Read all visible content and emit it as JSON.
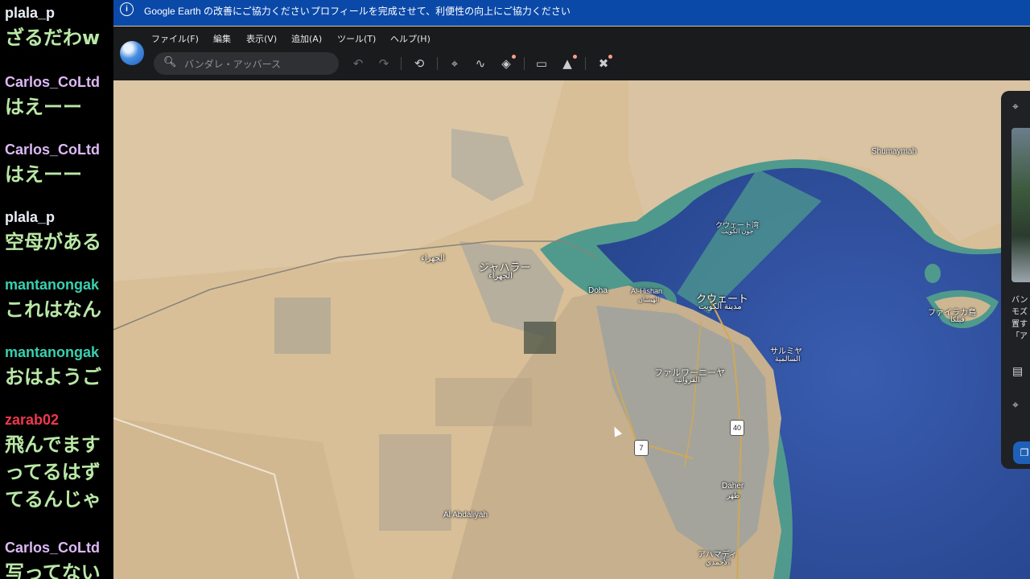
{
  "chat": {
    "messages": [
      {
        "user": "plala_p",
        "user_color": "#e9eef5",
        "lines": [
          "ざるだわw"
        ]
      },
      {
        "user": "Carlos_CoLtd",
        "user_color": "#dcb8f5",
        "lines": [
          "はえーー"
        ]
      },
      {
        "user": "Carlos_CoLtd",
        "user_color": "#dcb8f5",
        "lines": [
          "はえーー"
        ]
      },
      {
        "user": "plala_p",
        "user_color": "#e9eef5",
        "lines": [
          "空母がある"
        ]
      },
      {
        "user": "mantanongak",
        "user_color": "#39d0b0",
        "lines": [
          "これはなん"
        ]
      },
      {
        "user": "mantanongak",
        "user_color": "#39d0b0",
        "lines": [
          "おはようご"
        ]
      },
      {
        "user": "zarab02",
        "user_color": "#f0384c",
        "lines": [
          "飛んでます",
          "ってるはず",
          "てるんじゃ"
        ]
      },
      {
        "user": "Carlos_CoLtd",
        "user_color": "#dcb8f5",
        "lines": [
          "写ってない"
        ]
      }
    ]
  },
  "banner": {
    "icon": "info-icon",
    "text1": "Google Earth の改善にご協力ください",
    "text2": "プロフィールを完成させて、利便性の向上にご協力ください"
  },
  "menu": {
    "file": "ファイル(F)",
    "edit": "編集",
    "view": "表示(V)",
    "add": "追加(A)",
    "tools": "ツール(T)",
    "help": "ヘルプ(H)"
  },
  "search": {
    "placeholder": "バンダレ・アッバース",
    "value": ""
  },
  "map": {
    "labels": {
      "shumaymah": "Shumaymah",
      "kuwait_bay_ja": "クウェート湾",
      "kuwait_bay_ar": "جون الكويت",
      "jahra_ar": "الجهراء",
      "jahra_ja": "ジャハラー",
      "jahra_ar2": "الجهراء",
      "doha": "Doha",
      "al_hishan": "Al-Hishan",
      "al_hishan_ar": "الهيشان",
      "kuwait_ja": "クウェート",
      "kuwait_ar": "مدينة الكويت",
      "failaka_ja": "ファイラカ島",
      "failaka_ar": "فيلكا",
      "salmiya_ja": "サルミヤ",
      "salmiya_ar": "السالمية",
      "farwaniya_ja": "ファルワーニーヤ",
      "farwaniya_ar": "الفروانية",
      "daher": "Daher",
      "daher_ar": "ظهر",
      "abdaliyah": "Al Abdaliyah",
      "ahmadi_ja": "アハマディ",
      "ahmadi_ar": "الأحمدي"
    },
    "road_40": "40",
    "road_7": "7"
  },
  "side_panel": {
    "lines": [
      "バン",
      "モズ",
      "置す",
      "「ア"
    ]
  },
  "colors": {
    "banner": "#0b49a8",
    "toolbar": "#1a1b1d",
    "sea": "#2d4fa0",
    "shallow": "#3f9a8a",
    "desert": "#d9c19a"
  }
}
